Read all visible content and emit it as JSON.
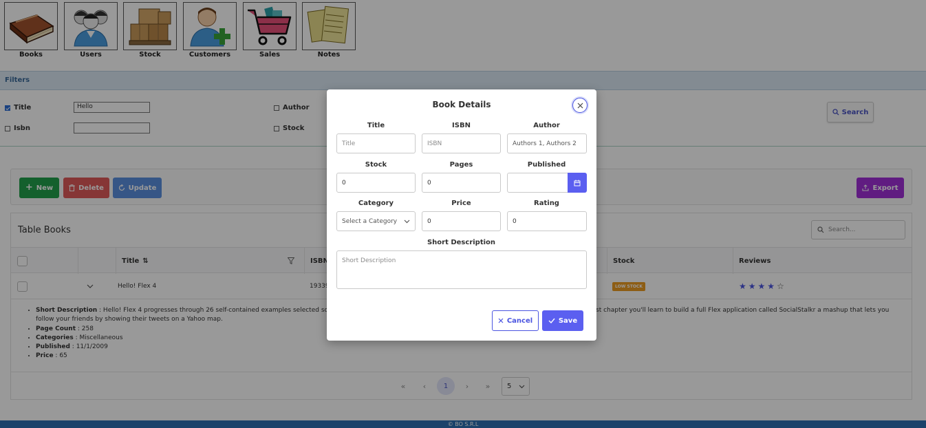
{
  "nav": {
    "items": [
      {
        "label": "Books",
        "icon": "books-icon"
      },
      {
        "label": "Users",
        "icon": "users-icon"
      },
      {
        "label": "Stock",
        "icon": "stock-boxes-icon"
      },
      {
        "label": "Customers",
        "icon": "add-customer-icon"
      },
      {
        "label": "Sales",
        "icon": "shopping-cart-icon"
      },
      {
        "label": "Notes",
        "icon": "notes-icon"
      }
    ]
  },
  "filters": {
    "title": "Filters",
    "fields": [
      {
        "label": "Title",
        "checked": true,
        "value": "Hello"
      },
      {
        "label": "Isbn",
        "checked": false,
        "value": ""
      },
      {
        "label": "Author",
        "checked": false
      },
      {
        "label": "Stock",
        "checked": false
      }
    ],
    "search_label": "Search"
  },
  "toolbar": {
    "new_label": "New",
    "delete_label": "Delete",
    "update_label": "Update",
    "export_label": "Export"
  },
  "table": {
    "title": "Table Books",
    "search_placeholder": "Search...",
    "columns": {
      "title": "Title",
      "isbn": "ISBN",
      "stock": "Stock",
      "reviews": "Reviews"
    },
    "row": {
      "title": "Hello! Flex 4",
      "isbn": "19339",
      "stock_badge": "LOW STOCK",
      "rating": 4,
      "rating_max": 5
    },
    "details": [
      {
        "key": "Short Description",
        "value": "Hello! Flex 4 progresses through 26 self-contained examples selected so you can p",
        "value_cont": "ect Four-like game. And in the last chapter you'll learn to build a full Flex application called SocialStalkr a mashup that lets you follow your friends by showing their tweets on a Yahoo map."
      },
      {
        "key": "Page Count",
        "value": "258"
      },
      {
        "key": "Categories",
        "value": "Miscellaneous"
      },
      {
        "key": "Published",
        "value": "11/1/2009"
      },
      {
        "key": "Price",
        "value": "65"
      }
    ],
    "paginator": {
      "current_page": "1",
      "rows_per_page": "5"
    }
  },
  "footer": {
    "text": "© BO S.R.L"
  },
  "modal": {
    "title": "Book Details",
    "fields": {
      "title": {
        "label": "Title",
        "placeholder": "Title",
        "value": ""
      },
      "isbn": {
        "label": "ISBN",
        "placeholder": "ISBN",
        "value": ""
      },
      "author": {
        "label": "Author",
        "placeholder": "Authors 1, Authors 2",
        "value": ""
      },
      "stock": {
        "label": "Stock",
        "value": "0"
      },
      "pages": {
        "label": "Pages",
        "value": "0"
      },
      "published": {
        "label": "Published",
        "value": ""
      },
      "category": {
        "label": "Category",
        "placeholder": "Select a Category"
      },
      "price": {
        "label": "Price",
        "value": "0"
      },
      "rating": {
        "label": "Rating",
        "value": "0"
      },
      "description": {
        "label": "Short Description",
        "placeholder": "Short Description"
      }
    },
    "cancel_label": "Cancel",
    "save_label": "Save"
  },
  "colors": {
    "primary": "#5b5ff0",
    "new_button": "#22a04b",
    "delete_button": "#e05a5a",
    "update_button": "#5a8fe0",
    "export_button": "#a02fd8",
    "badge_low_stock": "#ec9c22",
    "footer": "#2d6fb1"
  }
}
